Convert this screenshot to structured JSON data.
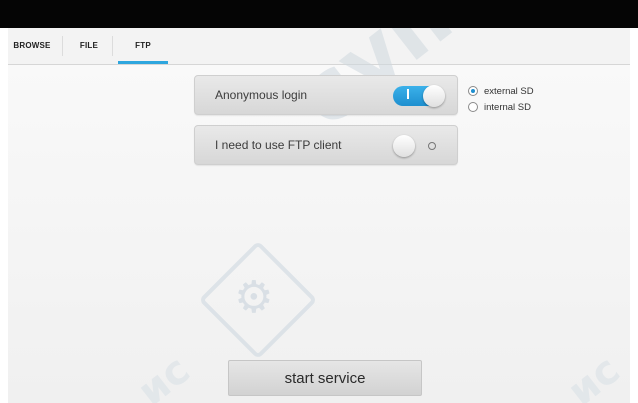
{
  "tabs": [
    {
      "label": "BROWSE",
      "active": false
    },
    {
      "label": "FILE",
      "active": false
    },
    {
      "label": "FTP",
      "active": true
    }
  ],
  "settings": {
    "anonymous_login": {
      "label": "Anonymous login",
      "enabled": true,
      "toggle_on_glyph": "I"
    },
    "ftp_client": {
      "label": "I need to use FTP client",
      "enabled": false,
      "toggle_off_glyph": "O"
    }
  },
  "storage": {
    "options": [
      {
        "label": "external SD",
        "selected": true
      },
      {
        "label": "internal SD",
        "selected": false
      }
    ]
  },
  "start_button": {
    "label": "start service"
  },
  "watermark": {
    "text": "cyпераис",
    "logo_icon": "gear-icon"
  },
  "colors": {
    "accent": "#2ea6de",
    "toggle_on": "#1e8fcf",
    "top_bar": "#050505"
  }
}
